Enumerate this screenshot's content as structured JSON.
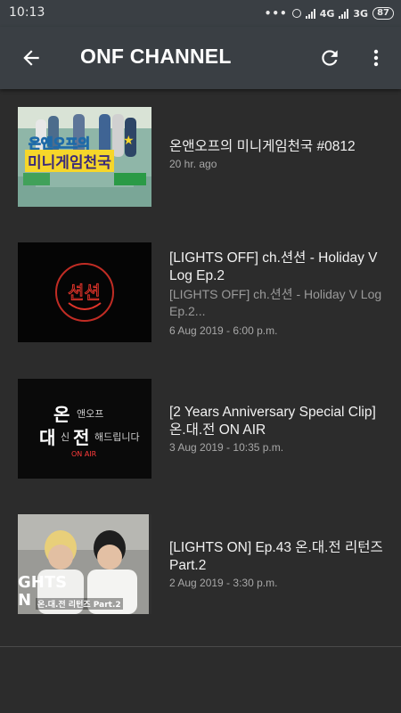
{
  "status_bar": {
    "time": "10:13",
    "network_1": "4G",
    "network_2": "3G",
    "battery": "87"
  },
  "toolbar": {
    "title": "ONF CHANNEL",
    "back_icon": "arrow-left-icon",
    "refresh_icon": "refresh-icon",
    "more_icon": "more-vert-icon"
  },
  "videos": [
    {
      "title": "온앤오프의 미니게임천국 #0812",
      "description": "",
      "date": "20 hr. ago",
      "thumb_caption_1": "온앤오프의",
      "thumb_caption_2": "미니게임천국"
    },
    {
      "title": "[LIGHTS OFF] ch.션션 - Holiday V Log Ep.2",
      "description": "[LIGHTS OFF] ch.션션 -  Holiday V Log Ep.2...",
      "date": "6 Aug 2019 - 6:00 p.m.",
      "thumb_caption_1": "션션"
    },
    {
      "title": "[2 Years Anniversary Special Clip] 온.대.전 ON AIR",
      "description": "",
      "date": "3 Aug 2019 - 10:35 p.m.",
      "thumb_caption_1": "온",
      "thumb_caption_2": "앤오프",
      "thumb_caption_3": "대",
      "thumb_caption_4": "신",
      "thumb_caption_5": "전",
      "thumb_caption_6": "해드립니다",
      "thumb_caption_7": "ON AIR"
    },
    {
      "title": "[LIGHTS ON] Ep.43 온.대.전 리턴즈 Part.2",
      "description": "",
      "date": "2 Aug 2019 - 3:30 p.m.",
      "thumb_caption_1": "GHTS",
      "thumb_caption_2": "N",
      "thumb_caption_3": "온.대.전 리턴즈 Part.2"
    }
  ]
}
